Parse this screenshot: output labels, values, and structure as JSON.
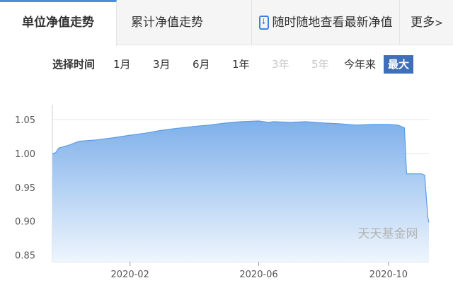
{
  "tabs": {
    "unit_nav": "单位净值走势",
    "cumulative_nav": "累计净值走势",
    "realtime_link": "随时随地查看最新净值",
    "more": "更多"
  },
  "period_selector": {
    "label": "选择时间",
    "options": [
      {
        "label": "1月",
        "state": "normal"
      },
      {
        "label": "3月",
        "state": "normal"
      },
      {
        "label": "6月",
        "state": "normal"
      },
      {
        "label": "1年",
        "state": "normal"
      },
      {
        "label": "3年",
        "state": "disabled"
      },
      {
        "label": "5年",
        "state": "disabled"
      },
      {
        "label": "今年来",
        "state": "normal"
      },
      {
        "label": "最大",
        "state": "active"
      }
    ]
  },
  "watermark": "天天基金网",
  "colors": {
    "accent": "#3f6fb8",
    "area_top": "#7eb0ea",
    "area_bottom": "#e9f2fc",
    "line": "#5b9ce6"
  },
  "chart_data": {
    "type": "area",
    "title": "",
    "xlabel": "",
    "ylabel": "",
    "ylim": [
      0.84,
      1.07
    ],
    "xlim": [
      "2019-11-20",
      "2020-11-08"
    ],
    "x_ticks": [
      "2020-02",
      "2020-06",
      "2020-10"
    ],
    "y_ticks": [
      "0.85",
      "0.90",
      "0.95",
      "1.00",
      "1.05"
    ],
    "grid": "horizontal",
    "series": [
      {
        "points": [
          [
            "2019-11-20",
            1.0
          ],
          [
            "2019-11-23",
            1.001
          ],
          [
            "2019-11-26",
            1.008
          ],
          [
            "2019-12-05",
            1.012
          ],
          [
            "2019-12-15",
            1.018
          ],
          [
            "2019-12-31",
            1.02
          ],
          [
            "2020-01-15",
            1.023
          ],
          [
            "2020-02-01",
            1.027
          ],
          [
            "2020-02-15",
            1.03
          ],
          [
            "2020-03-01",
            1.034
          ],
          [
            "2020-03-15",
            1.037
          ],
          [
            "2020-04-01",
            1.04
          ],
          [
            "2020-04-15",
            1.042
          ],
          [
            "2020-05-01",
            1.045
          ],
          [
            "2020-05-15",
            1.047
          ],
          [
            "2020-06-01",
            1.048
          ],
          [
            "2020-06-10",
            1.046
          ],
          [
            "2020-06-15",
            1.047
          ],
          [
            "2020-07-01",
            1.046
          ],
          [
            "2020-07-15",
            1.047
          ],
          [
            "2020-08-01",
            1.045
          ],
          [
            "2020-08-15",
            1.044
          ],
          [
            "2020-09-01",
            1.042
          ],
          [
            "2020-09-15",
            1.043
          ],
          [
            "2020-10-01",
            1.043
          ],
          [
            "2020-10-10",
            1.042
          ],
          [
            "2020-10-16",
            1.038
          ],
          [
            "2020-10-18",
            0.97
          ],
          [
            "2020-11-01",
            0.97
          ],
          [
            "2020-11-04",
            0.968
          ],
          [
            "2020-11-07",
            0.905
          ],
          [
            "2020-11-08",
            0.898
          ]
        ]
      }
    ]
  }
}
